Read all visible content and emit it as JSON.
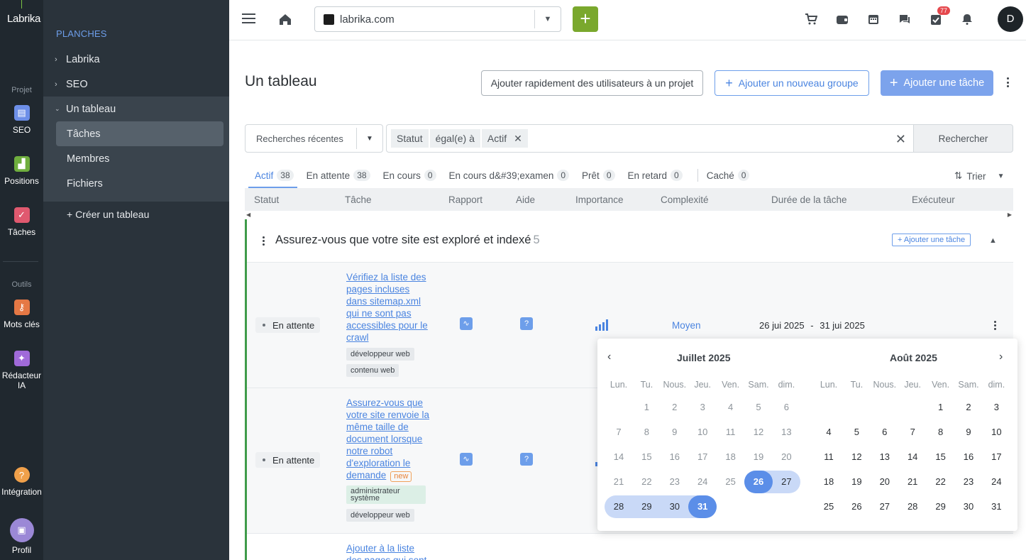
{
  "rail": {
    "logo": "Labrika",
    "section_project": "Projet",
    "seo": "SEO",
    "positions": "Positions",
    "taches": "Tâches",
    "section_tools": "Outils",
    "mots_cles": "Mots clés",
    "redacteur": "Rédacteur IA",
    "integration": "Intégration",
    "profil": "Profil"
  },
  "sidenav": {
    "title": "PLANCHES",
    "items": [
      "Labrika",
      "SEO",
      "Un tableau"
    ],
    "sub": [
      "Tâches",
      "Membres",
      "Fichiers"
    ],
    "create": "+ Créer un tableau"
  },
  "topbar": {
    "site": "labrika.com",
    "notif_count": "77",
    "avatar": "D"
  },
  "page": {
    "title": "Un tableau",
    "btn_quick_add": "Ajouter rapidement des utilisateurs à un projet",
    "btn_new_group": "Ajouter un nouveau groupe",
    "btn_add_task": "Ajouter une tâche"
  },
  "filter": {
    "recent": "Recherches récentes",
    "chip_field": "Statut",
    "chip_op": "égal(e) à",
    "chip_value": "Actif",
    "search": "Rechercher"
  },
  "tabs": [
    {
      "label": "Actif",
      "count": "38"
    },
    {
      "label": "En attente",
      "count": "38"
    },
    {
      "label": "En cours",
      "count": "0"
    },
    {
      "label": "En cours d&#39;examen",
      "count": "0"
    },
    {
      "label": "Prêt",
      "count": "0"
    },
    {
      "label": "En retard",
      "count": "0"
    },
    {
      "label": "Caché",
      "count": "0"
    }
  ],
  "sort_label": "Trier",
  "columns": [
    "Statut",
    "Tâche",
    "Rapport",
    "Aide",
    "Importance",
    "Complexité",
    "Durée de la tâche",
    "Exécuteur"
  ],
  "group": {
    "title": "Assurez-vous que votre site est exploré et indexé",
    "count": "5",
    "add_task": "+ Ajouter une tâche"
  },
  "rows": [
    {
      "status": "En attente",
      "task": "Vérifiez la liste des pages incluses dans sitemap.xml qui ne sont pas accessibles pour le crawl",
      "tags": [
        "développeur web",
        "contenu web"
      ],
      "complexity": "Moyen",
      "date_start": "26 jui 2025",
      "date_sep": "-",
      "date_end": "31 jui 2025"
    },
    {
      "status": "En attente",
      "task": "Assurez-vous que votre site renvoie la même taille de document lorsque notre robot d'exploration le demande",
      "new_badge": "new",
      "tags": [
        "administrateur système",
        "développeur web"
      ]
    },
    {
      "task": "Ajouter à la liste des pages qui sont"
    }
  ],
  "calendar": {
    "month1": "Juillet 2025",
    "month2": "Août 2025",
    "weekdays": [
      "Lun.",
      "Tu.",
      "Nous.",
      "Jeu.",
      "Ven.",
      "Sam.",
      "dim."
    ],
    "month1_days": [
      [
        "",
        "1",
        "2",
        "3",
        "4",
        "5",
        "6"
      ],
      [
        "7",
        "8",
        "9",
        "10",
        "11",
        "12",
        "13"
      ],
      [
        "14",
        "15",
        "16",
        "17",
        "18",
        "19",
        "20"
      ],
      [
        "21",
        "22",
        "23",
        "24",
        "25",
        "26",
        "27"
      ],
      [
        "28",
        "29",
        "30",
        "31",
        "",
        "",
        ""
      ]
    ],
    "month2_days": [
      [
        "",
        "",
        "",
        "",
        "1",
        "2",
        "3"
      ],
      [
        "4",
        "5",
        "6",
        "7",
        "8",
        "9",
        "10"
      ],
      [
        "11",
        "12",
        "13",
        "14",
        "15",
        "16",
        "17"
      ],
      [
        "18",
        "19",
        "20",
        "21",
        "22",
        "23",
        "24"
      ],
      [
        "25",
        "26",
        "27",
        "28",
        "29",
        "30",
        "31"
      ]
    ],
    "range_start": "26",
    "range_end": "31"
  },
  "colors": {
    "accent": "#6d9eea",
    "green": "#7aa82d",
    "rail_bg": "#20282f",
    "nav_bg": "#2a333b"
  }
}
